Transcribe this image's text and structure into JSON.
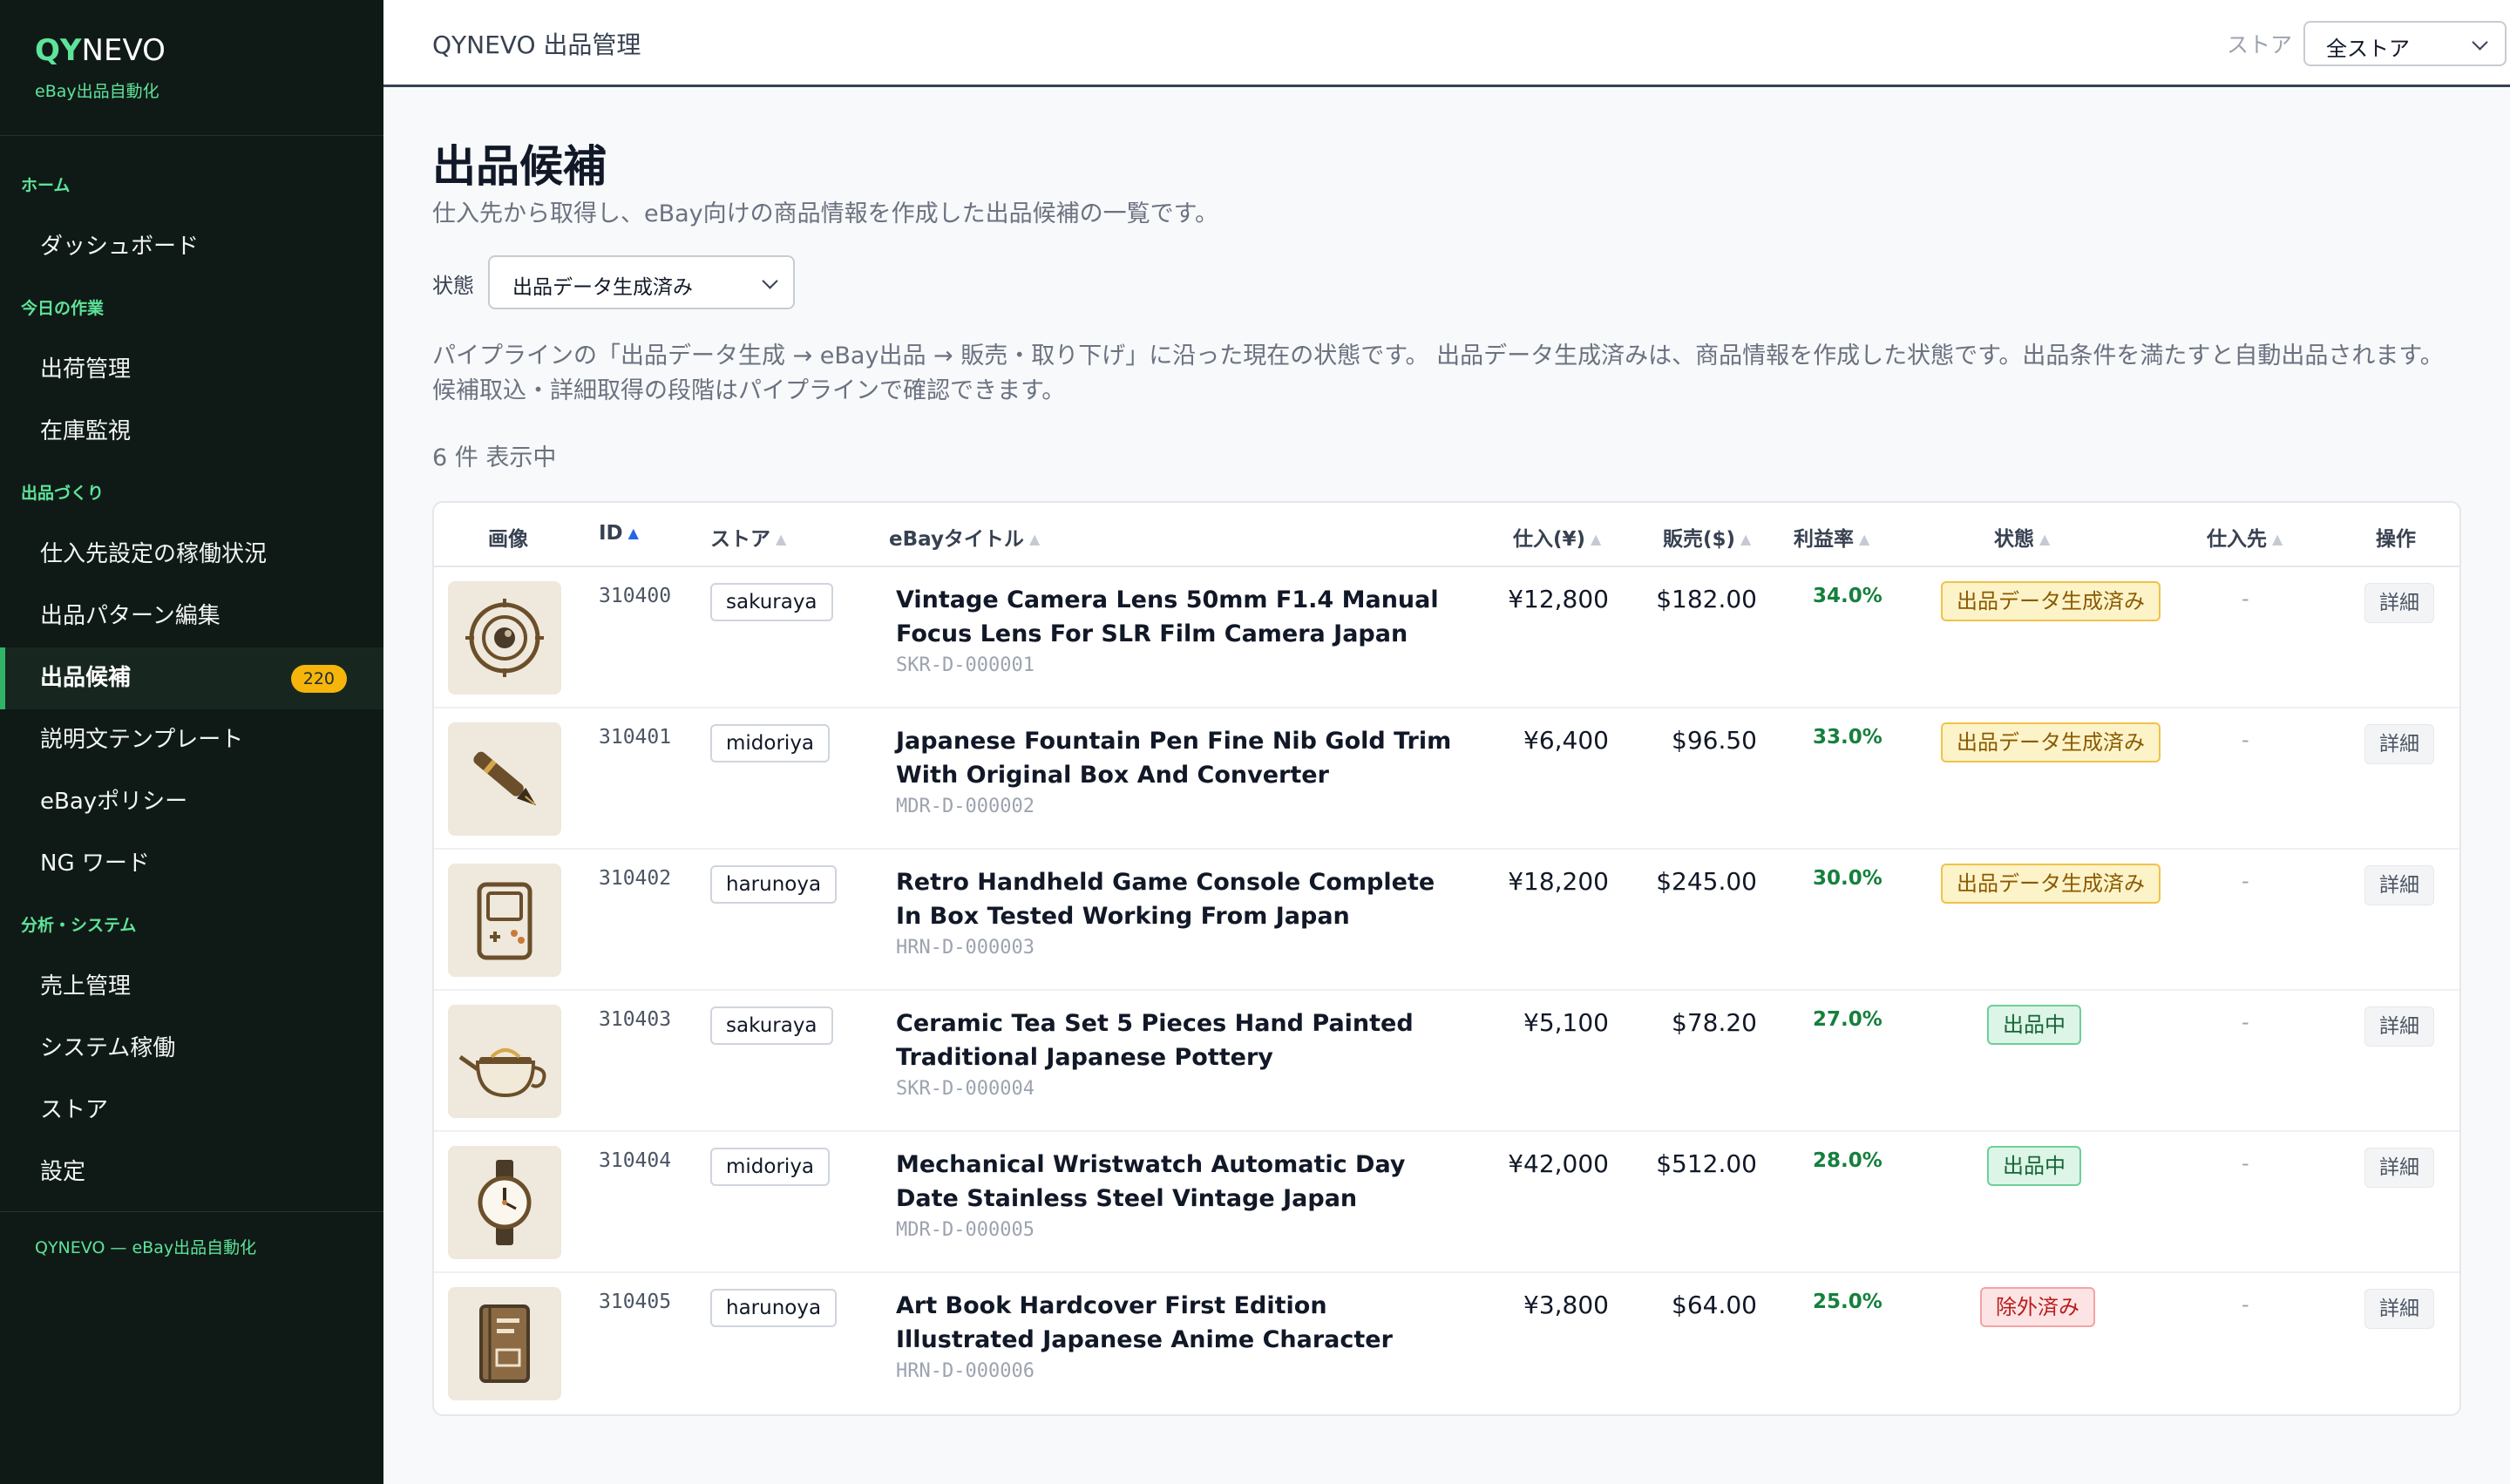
{
  "brand": {
    "logo_accent": "QY",
    "logo_rest": "NEVO",
    "subtitle": "eBay出品自動化"
  },
  "sidebar": {
    "sections": [
      {
        "title": "ホーム",
        "items": [
          {
            "label": "ダッシュボード"
          }
        ]
      },
      {
        "title": "今日の作業",
        "items": [
          {
            "label": "出荷管理"
          },
          {
            "label": "在庫監視"
          }
        ]
      },
      {
        "title": "出品づくり",
        "items": [
          {
            "label": "仕入先設定の稼働状況"
          },
          {
            "label": "出品パターン編集"
          },
          {
            "label": "出品候補",
            "active": true,
            "badge": "220"
          },
          {
            "label": "説明文テンプレート"
          },
          {
            "label": "eBayポリシー"
          },
          {
            "label": "NG ワード"
          }
        ]
      },
      {
        "title": "分析・システム",
        "items": [
          {
            "label": "売上管理"
          },
          {
            "label": "システム稼働"
          },
          {
            "label": "ストア"
          },
          {
            "label": "設定"
          }
        ]
      }
    ],
    "footer": "QYNEVO — eBay出品自動化"
  },
  "topbar": {
    "title": "QYNEVO 出品管理",
    "store_label": "ストア",
    "store_value": "全ストア"
  },
  "page": {
    "title": "出品候補",
    "subtitle": "仕入先から取得し、eBay向けの商品情報を作成した出品候補の一覧です。",
    "filter_label": "状態",
    "filter_value": "出品データ生成済み",
    "pipeline_note": "パイプラインの「出品データ生成 → eBay出品 → 販売・取り下げ」に沿った現在の状態です。 出品データ生成済みは、商品情報を作成した状態です。出品条件を満たすと自動出品されます。 候補取込・詳細取得の段階はパイプラインで確認できます。",
    "count_text": "6 件 表示中"
  },
  "table": {
    "columns": {
      "image": "画像",
      "id": "ID",
      "store": "ストア",
      "title": "eBayタイトル",
      "cost": "仕入(¥)",
      "price": "販売($)",
      "margin": "利益率",
      "status": "状態",
      "supplier": "仕入先",
      "actions": "操作"
    },
    "sort_asc_glyph": "▲",
    "rows": [
      {
        "icon": "camera-lens-icon",
        "id": "310400",
        "store": "sakuraya",
        "title": "Vintage Camera Lens 50mm F1.4 Manual Focus Lens For SLR Film Camera Japan",
        "sku": "SKR-D-000001",
        "cost": "¥12,800",
        "price": "$182.00",
        "margin": "34.0%",
        "status": "出品データ生成済み",
        "status_type": "generated",
        "supplier": "-",
        "action": "詳細"
      },
      {
        "icon": "fountain-pen-icon",
        "id": "310401",
        "store": "midoriya",
        "title": "Japanese Fountain Pen Fine Nib Gold Trim With Original Box And Converter",
        "sku": "MDR-D-000002",
        "cost": "¥6,400",
        "price": "$96.50",
        "margin": "33.0%",
        "status": "出品データ生成済み",
        "status_type": "generated",
        "supplier": "-",
        "action": "詳細"
      },
      {
        "icon": "handheld-console-icon",
        "id": "310402",
        "store": "harunoya",
        "title": "Retro Handheld Game Console Complete In Box Tested Working From Japan",
        "sku": "HRN-D-000003",
        "cost": "¥18,200",
        "price": "$245.00",
        "margin": "30.0%",
        "status": "出品データ生成済み",
        "status_type": "generated",
        "supplier": "-",
        "action": "詳細"
      },
      {
        "icon": "teapot-icon",
        "id": "310403",
        "store": "sakuraya",
        "title": "Ceramic Tea Set 5 Pieces Hand Painted Traditional Japanese Pottery",
        "sku": "SKR-D-000004",
        "cost": "¥5,100",
        "price": "$78.20",
        "margin": "27.0%",
        "status": "出品中",
        "status_type": "listed",
        "supplier": "-",
        "action": "詳細"
      },
      {
        "icon": "wristwatch-icon",
        "id": "310404",
        "store": "midoriya",
        "title": "Mechanical Wristwatch Automatic Day Date Stainless Steel Vintage Japan",
        "sku": "MDR-D-000005",
        "cost": "¥42,000",
        "price": "$512.00",
        "margin": "28.0%",
        "status": "出品中",
        "status_type": "listed",
        "supplier": "-",
        "action": "詳細"
      },
      {
        "icon": "book-icon",
        "id": "310405",
        "store": "harunoya",
        "title": "Art Book Hardcover First Edition Illustrated Japanese Anime Character",
        "sku": "HRN-D-000006",
        "cost": "¥3,800",
        "price": "$64.00",
        "margin": "25.0%",
        "status": "除外済み",
        "status_type": "excluded",
        "supplier": "-",
        "action": "詳細"
      }
    ]
  },
  "colors": {
    "sidebar_bg": "#0f1a16",
    "brand_accent": "#5ee39a",
    "active_border": "#2fb565",
    "badge": "#f5b50a",
    "margin_green": "#15803d",
    "sort_active": "#2563eb"
  }
}
